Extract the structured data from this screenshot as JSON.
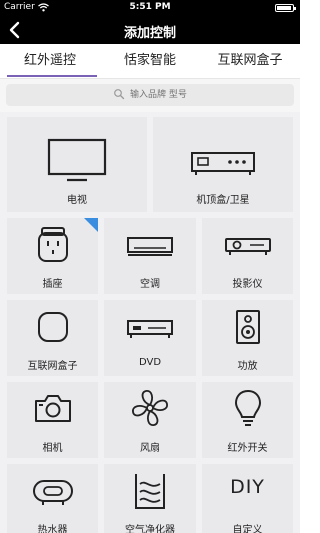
{
  "status": {
    "carrier": "Carrier",
    "time": "5:51 PM",
    "battery_level": 0.9
  },
  "nav": {
    "title": "添加控制"
  },
  "tabs": [
    {
      "label": "红外遥控",
      "active": true
    },
    {
      "label": "恬家智能",
      "active": false
    },
    {
      "label": "互联网盒子",
      "active": false
    }
  ],
  "search": {
    "placeholder": "输入品牌 型号"
  },
  "devices": [
    {
      "label": "电视",
      "icon": "tv-icon"
    },
    {
      "label": "机顶盒/卫星",
      "icon": "set-top-box-icon"
    },
    {
      "label": "插座",
      "icon": "smart-plug-icon",
      "badge": true
    },
    {
      "label": "空调",
      "icon": "air-conditioner-icon"
    },
    {
      "label": "投影仪",
      "icon": "projector-icon"
    },
    {
      "label": "互联网盒子",
      "icon": "internet-box-icon"
    },
    {
      "label": "DVD",
      "icon": "dvd-player-icon"
    },
    {
      "label": "功放",
      "icon": "speaker-icon"
    },
    {
      "label": "相机",
      "icon": "camera-icon"
    },
    {
      "label": "风扇",
      "icon": "fan-icon"
    },
    {
      "label": "红外开关",
      "icon": "bulb-icon"
    },
    {
      "label": "热水器",
      "icon": "water-heater-icon"
    },
    {
      "label": "空气净化器",
      "icon": "air-purifier-icon"
    },
    {
      "label": "自定义",
      "icon": "diy-icon",
      "icon_text": "DIY"
    }
  ],
  "colors": {
    "accent": "#7a62b7",
    "badge": "#3b8de0",
    "bar": "#000000",
    "card": "#e9e9ec"
  }
}
